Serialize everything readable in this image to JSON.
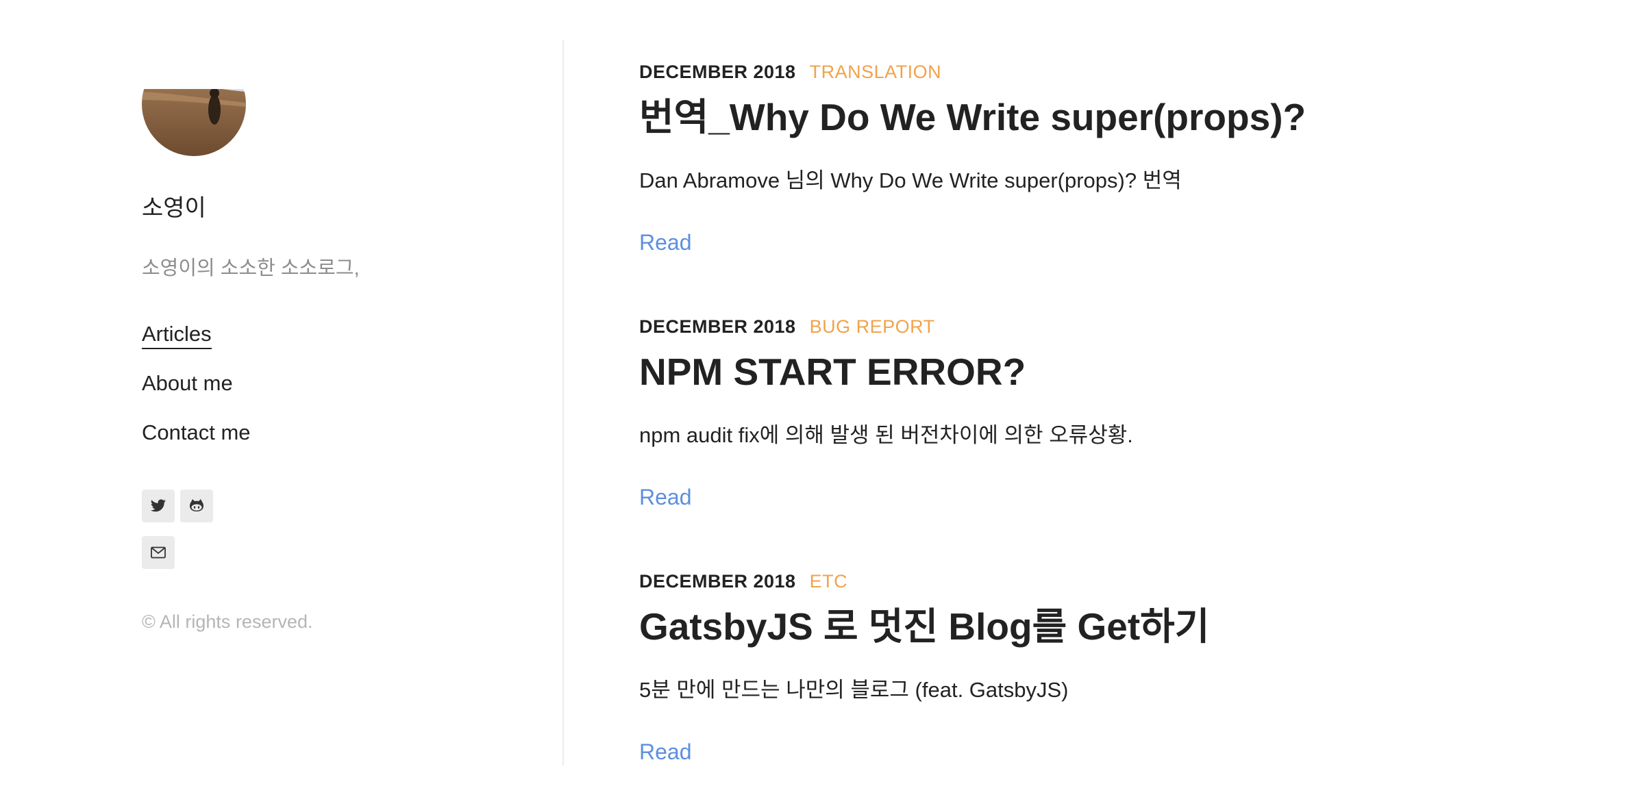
{
  "sidebar": {
    "author_name": "소영이",
    "author_subtitle": "소영이의 소소한 소소로그,",
    "nav": {
      "articles": "Articles",
      "about": "About me",
      "contact": "Contact me"
    },
    "social_icons": [
      "twitter-icon",
      "github-icon",
      "mail-icon"
    ],
    "copyright": "© All rights reserved."
  },
  "posts": [
    {
      "date": "DECEMBER 2018",
      "category": "TRANSLATION",
      "title": "번역_Why Do We Write super(props)?",
      "description": "Dan Abramove 님의 Why Do We Write super(props)? 번역",
      "read_label": "Read"
    },
    {
      "date": "DECEMBER 2018",
      "category": "BUG REPORT",
      "title": "NPM START ERROR?",
      "description": "npm audit fix에 의해 발생 된 버전차이에 의한 오류상황.",
      "read_label": "Read"
    },
    {
      "date": "DECEMBER 2018",
      "category": "ETC",
      "title": "GatsbyJS 로 멋진 Blog를 Get하기",
      "description": "5분 만에 만드는 나만의 블로그 (feat. GatsbyJS)",
      "read_label": "Read"
    }
  ],
  "colors": {
    "category": "#f2a24a",
    "link": "#5b8fe0",
    "muted_text": "#8c8c8c",
    "copyright_text": "#b5b5b5",
    "social_bg": "#ebebeb"
  }
}
